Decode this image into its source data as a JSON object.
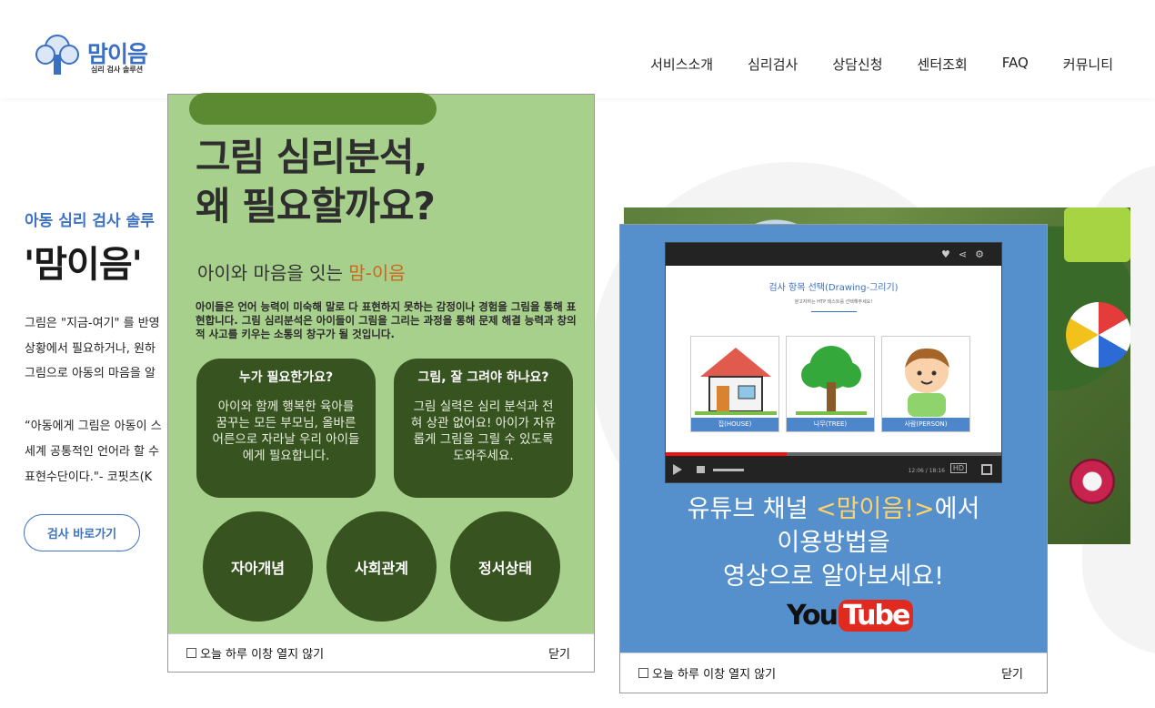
{
  "header": {
    "logo_name": "맘이음",
    "logo_sub": "심리 검사 솔루션",
    "nav": [
      "서비스소개",
      "심리검사",
      "상담신청",
      "센터조회",
      "FAQ",
      "커뮤니티"
    ]
  },
  "hero": {
    "subtitle": "아동 심리 검사 솔루",
    "title": "'맘이음'",
    "lines": [
      "그림은 \"지금-여기\" 를 반영",
      "상황에서 필요하거나, 원하",
      "그림으로 아동의 마음을 알",
      "“아동에게 그림은 아동이 스",
      "세계 공통적인 언어라 할 수",
      "표현수단이다.\"- 코핏츠(K"
    ],
    "cta": "검사 바로가기"
  },
  "popup1": {
    "title": "그림 심리분석,\n왜 필요할까요?",
    "subtitle_prefix": "아이와 마음을 잇는 ",
    "subtitle_highlight": "맘-이음",
    "body": "아이들은 언어 능력이 미숙해 말로 다 표현하지 못하는 감정이나 경험을 그림을 통해 표현합니다. 그림 심리분석은 아이들이 그림을 그리는 과정을 통해 문제 해결 능력과 창의적 사고를 키우는 소통의 창구가 될 것입니다.",
    "cards": [
      {
        "title": "누가 필요한가요?",
        "body": "아이와 함께 행복한 육아를 꿈꾸는 모든 부모님, 올바른 어른으로 자라날 우리 아이들에게 필요합니다."
      },
      {
        "title": "그림, 잘 그려야 하나요?",
        "body": "그림 실력은 심리 분석과 전혀 상관 없어요! 아이가 자유롭게 그림을 그릴 수 있도록 도와주세요."
      }
    ],
    "circles": [
      "자아개념",
      "사회관계",
      "정서상태"
    ],
    "footer_checkbox": "오늘 하루 이창 열지 않기",
    "footer_close": "닫기"
  },
  "popup2": {
    "video": {
      "title": "검사 항목 선택(Drawing-그리기)",
      "subtitle": "분고자하는 HTP 테스트를 선택해주세요!",
      "cards": [
        "집(HOUSE)",
        "나무(TREE)",
        "사람(PERSON)"
      ],
      "time": "12:06 / 18:16",
      "hd": "HD",
      "progress": 0.36
    },
    "line1_prefix": "유튜브 채널 ",
    "line1_highlight": "<맘이음!>",
    "line1_suffix": "에서",
    "line2": "이용방법을",
    "line3": "영상으로 알아보세요!",
    "yt_you": "You",
    "yt_tube": "Tube",
    "footer_checkbox": "오늘 하루 이창 열지 않기",
    "footer_close": "닫기"
  }
}
